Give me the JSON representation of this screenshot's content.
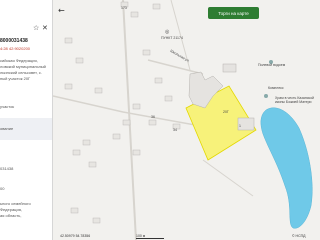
{
  "panel": {
    "cadastral_number": "8000031438",
    "subtitle": "4:28 42:9020200",
    "address_lines": [
      "сийская Федерация,",
      "ловский муниципальный",
      "льинский сельсовет, с.",
      "ный участок 20Г"
    ],
    "section_1": "участок",
    "section_2": "ование",
    "section_3": "031438",
    "section_4": "00",
    "footer_lines": [
      "ьного семейного",
      "Федерация,",
      "ая область,"
    ]
  },
  "map": {
    "back_icon": "arrow-left-icon",
    "share_icon": "share-icon",
    "star_icon": "star-icon",
    "close_icon": "close-icon",
    "poi_icon": "poi-icon",
    "road_label": "Школьная ул.",
    "poi_label": "ПУНКТ 21174",
    "pond_label": "Полевой водоем",
    "estate_label": "Комплекс",
    "church_label": "Храм в честь Казанской иконы Божией Матери",
    "parcel_numbers": [
      "173",
      "20Г",
      "1",
      "36",
      "34"
    ],
    "green_button": "Торги на карте",
    "coords": "42.50979  54.78356",
    "scale": "100 м",
    "copyright": "© НСПД"
  },
  "colors": {
    "parcel_fill": "#f7f27a",
    "parcel_stroke": "#e3d800",
    "water": "#6fc9e8",
    "button": "#2e7d32"
  }
}
